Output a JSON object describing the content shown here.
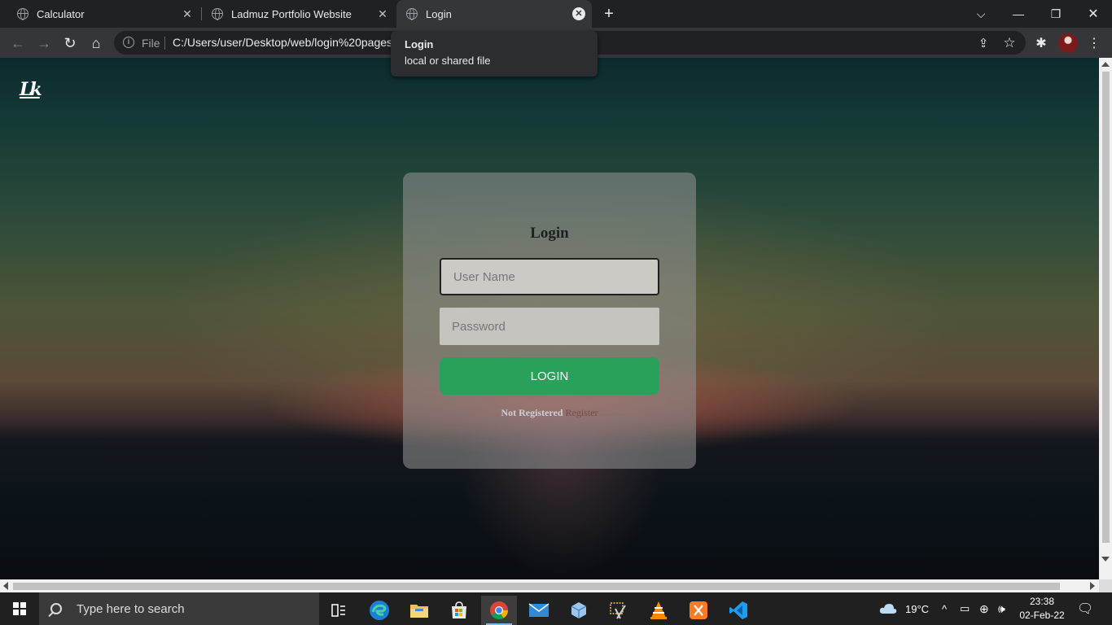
{
  "browser": {
    "tabs": [
      {
        "title": "Calculator",
        "active": false
      },
      {
        "title": "Ladmuz Portfolio Website",
        "active": false
      },
      {
        "title": "Login",
        "active": true
      }
    ],
    "new_tab_glyph": "+",
    "address": {
      "scheme_label": "File",
      "url": "C:/Users/user/Desktop/web/login%20pages"
    },
    "tooltip": {
      "title": "Login",
      "subtitle": "local or shared file"
    },
    "window_controls": [
      "minimize",
      "restore",
      "close"
    ]
  },
  "page": {
    "logo_text": "Lk",
    "form": {
      "title": "Login",
      "username_placeholder": "User Name",
      "password_placeholder": "Password",
      "submit_label": "LOGIN",
      "not_registered_text": "Not Registered",
      "register_link": "Register"
    }
  },
  "taskbar": {
    "search_placeholder": "Type here to search",
    "weather": "19°C",
    "time": "23:38",
    "date": "02-Feb-22",
    "apps": [
      "task-view",
      "edge",
      "file-explorer",
      "microsoft-store",
      "chrome",
      "mail",
      "3d-viewer",
      "snipping-tool",
      "vlc",
      "xampp",
      "vscode"
    ],
    "active_app": "chrome"
  },
  "colors": {
    "accent_green": "#2aa15a",
    "register_link": "#7a4b45",
    "browser_dark": "#202124"
  }
}
